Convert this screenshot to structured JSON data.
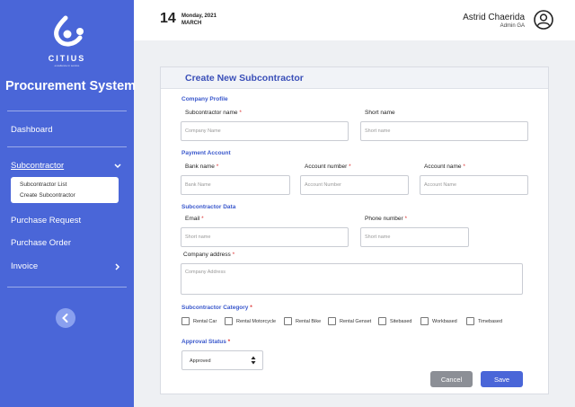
{
  "brand": {
    "name": "CITIUS",
    "tagline": "excellence in service"
  },
  "app_title": "Procurement System",
  "nav": {
    "dashboard": "Dashboard",
    "subcontractor": "Subcontractor",
    "subcontractor_list": "Subcontractor List",
    "create_subcontractor": "Create Subcontractor",
    "purchase_request": "Purchase Request",
    "purchase_order": "Purchase Order",
    "invoice": "Invoice"
  },
  "header": {
    "date_day_num": "14",
    "date_weekday": "Monday, 2021",
    "date_month": "MARCH",
    "user_name": "Astrid Chaerida",
    "user_role": "Admin GA"
  },
  "form": {
    "title": "Create New Subcontractor",
    "company_profile": {
      "section": "Company Profile",
      "name_label": "Subcontractor name",
      "name_placeholder": "Company Name",
      "short_label": "Short name",
      "short_placeholder": "Short name"
    },
    "payment_account": {
      "section": "Payment Account",
      "bank_label": "Bank name",
      "bank_placeholder": "Bank Name",
      "number_label": "Account number",
      "number_placeholder": "Account Number",
      "name_label": "Account name",
      "name_placeholder": "Account Name"
    },
    "subcontractor_data": {
      "section": "Subcontractor Data",
      "email_label": "Email",
      "email_placeholder": "Short name",
      "phone_label": "Phone number",
      "phone_placeholder": "Short name",
      "address_label": "Company address",
      "address_placeholder": "Company Address"
    },
    "category": {
      "section": "Subcontractor Category",
      "options": [
        "Rental Car",
        "Rental Motorcycle",
        "Rental Bike",
        "Rental Genset",
        "Sitebased",
        "Workbased",
        "Timebased"
      ]
    },
    "approval": {
      "section": "Approval Status",
      "selected": "Approved"
    },
    "buttons": {
      "cancel": "Cancel",
      "save": "Save"
    },
    "required_mark": "*"
  },
  "colors": {
    "primary": "#4a66d8",
    "cancel": "#8c8f96",
    "section": "#3a58cc",
    "required": "#dd3333"
  }
}
